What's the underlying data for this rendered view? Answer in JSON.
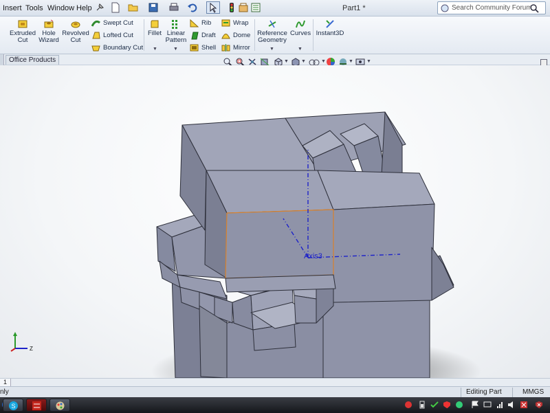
{
  "menubar": {
    "items": [
      "Insert",
      "Tools",
      "Window",
      "Help"
    ],
    "doc_title": "Part1 *",
    "search_placeholder": "Search Community Forum"
  },
  "features": {
    "extruded_cut": "Extruded\nCut",
    "hole_wizard": "Hole\nWizard",
    "revolved_cut": "Revolved\nCut",
    "swept_cut": "Swept Cut",
    "lofted_cut": "Lofted Cut",
    "boundary_cut": "Boundary Cut",
    "fillet": "Fillet",
    "linear_pattern": "Linear\nPattern",
    "rib": "Rib",
    "draft": "Draft",
    "shell": "Shell",
    "wrap": "Wrap",
    "dome": "Dome",
    "mirror": "Mirror",
    "reference_geometry": "Reference\nGeometry",
    "curves": "Curves",
    "instant3d": "Instant3D"
  },
  "tabs": {
    "office_products": "Office Products",
    "sheet": "1"
  },
  "viewport": {
    "axis_label": "Axis3",
    "triad_z": "Z"
  },
  "statusbar": {
    "left_text": "nly",
    "editing": "Editing Part",
    "units": "MMGS"
  },
  "colors": {
    "face_top": "#9ea2b6",
    "face_front": "#8f93a8",
    "face_side": "#7b7f93",
    "edge": "#2d2f3a",
    "selection": "#d9822b",
    "axis": "#1d22c9"
  }
}
